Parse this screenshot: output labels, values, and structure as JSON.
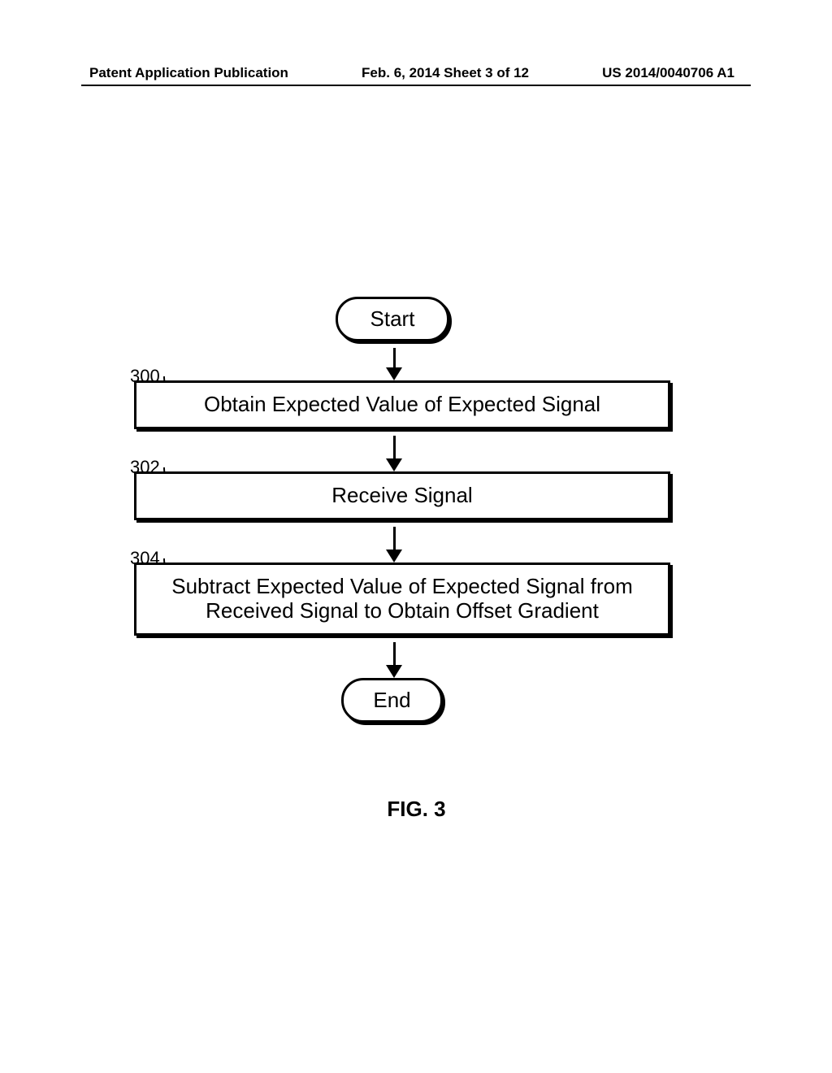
{
  "header": {
    "left": "Patent Application Publication",
    "center": "Feb. 6, 2014   Sheet 3 of 12",
    "right": "US 2014/0040706 A1"
  },
  "flowchart": {
    "start": "Start",
    "end": "End",
    "steps": [
      {
        "ref": "300",
        "text": "Obtain Expected Value of Expected Signal"
      },
      {
        "ref": "302",
        "text": "Receive Signal"
      },
      {
        "ref": "304",
        "text": "Subtract Expected Value of Expected Signal from Received Signal to Obtain Offset Gradient"
      }
    ]
  },
  "figure_label": "FIG. 3"
}
